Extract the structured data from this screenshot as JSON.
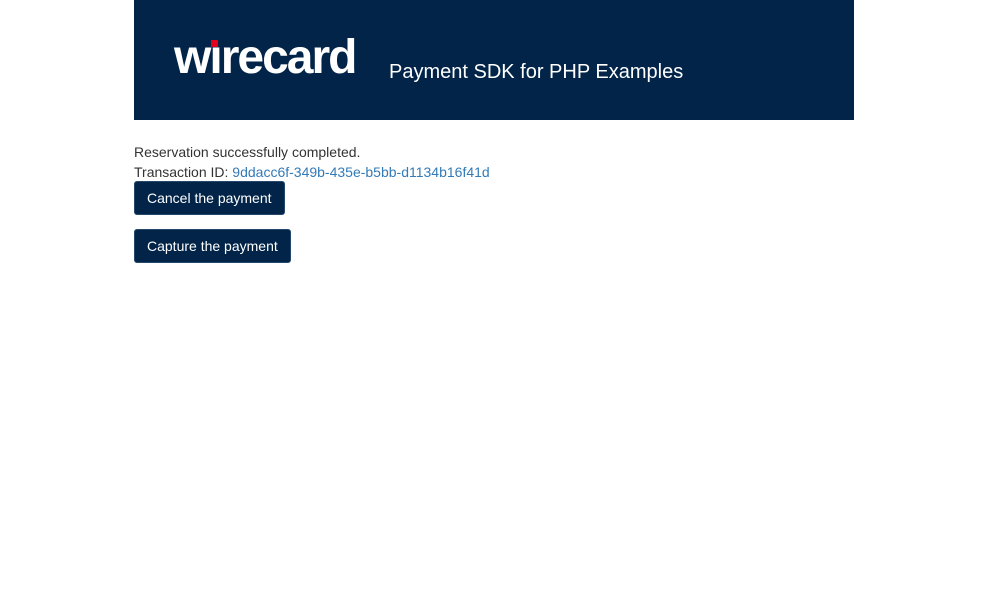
{
  "header": {
    "logo_text_w": "w",
    "logo_text_i": "ı",
    "logo_text_rest": "recard",
    "logo_accent_color": "#e3001b",
    "background_color": "#012448",
    "title": "Payment SDK for PHP Examples"
  },
  "content": {
    "message": "Reservation successfully completed.",
    "transaction_label": "Transaction ID: ",
    "transaction_id": "9ddacc6f-349b-435e-b5bb-d1134b16f41d"
  },
  "actions": {
    "cancel_label": "Cancel the payment",
    "capture_label": "Capture the payment"
  }
}
